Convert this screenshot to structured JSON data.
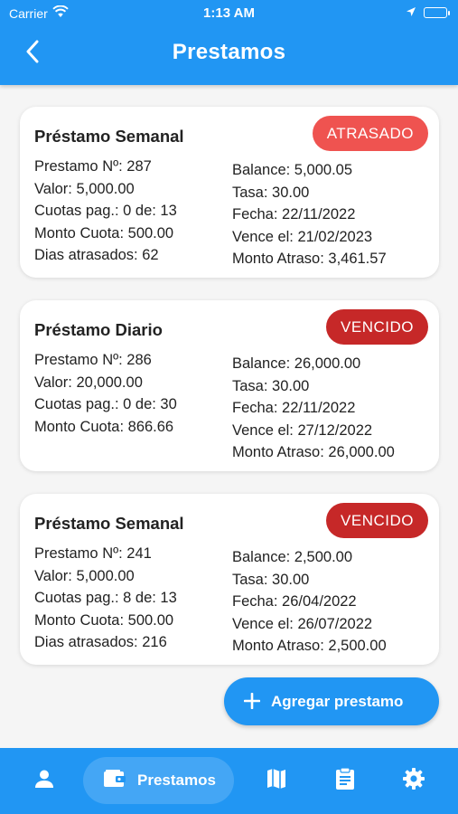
{
  "status_bar": {
    "carrier": "Carrier",
    "time": "1:13 AM"
  },
  "header": {
    "title": "Prestamos"
  },
  "loans": [
    {
      "title": "Préstamo Semanal",
      "badge": "ATRASADO",
      "badge_color": "#ef5350",
      "left": [
        "Prestamo Nº: 287",
        "Valor: 5,000.00",
        "Cuotas pag.: 0 de: 13",
        "Monto Cuota: 500.00",
        "Dias atrasados: 62"
      ],
      "right": [
        "Balance: 5,000.05",
        "Tasa: 30.00",
        "Fecha: 22/11/2022",
        "Vence el: 21/02/2023",
        "Monto Atraso: 3,461.57"
      ]
    },
    {
      "title": "Préstamo Diario",
      "badge": "VENCIDO",
      "badge_color": "#c62828",
      "left": [
        "Prestamo Nº: 286",
        "Valor: 20,000.00",
        "Cuotas pag.: 0 de: 30",
        "Monto Cuota: 866.66"
      ],
      "right": [
        "Balance: 26,000.00",
        "Tasa: 30.00",
        "Fecha: 22/11/2022",
        "Vence el: 27/12/2022",
        "Monto Atraso: 26,000.00"
      ]
    },
    {
      "title": "Préstamo Semanal",
      "badge": "VENCIDO",
      "badge_color": "#c62828",
      "left": [
        "Prestamo Nº: 241",
        "Valor: 5,000.00",
        "Cuotas pag.: 8 de: 13",
        "Monto Cuota: 500.00",
        "Dias atrasados: 216"
      ],
      "right": [
        "Balance: 2,500.00",
        "Tasa: 30.00",
        "Fecha: 26/04/2022",
        "Vence el: 26/07/2022",
        "Monto Atraso: 2,500.00"
      ]
    }
  ],
  "fab": {
    "label": "Agregar prestamo",
    "icon": "plus-icon"
  },
  "bottom_nav": {
    "items": [
      {
        "icon": "person-icon"
      },
      {
        "icon": "wallet-icon",
        "label": "Prestamos",
        "active": true
      },
      {
        "icon": "map-icon"
      },
      {
        "icon": "clipboard-icon"
      },
      {
        "icon": "gear-icon"
      }
    ]
  },
  "colors": {
    "primary": "#2196f3",
    "background": "#f5f5f5",
    "overdue": "#ef5350",
    "expired": "#c62828"
  }
}
